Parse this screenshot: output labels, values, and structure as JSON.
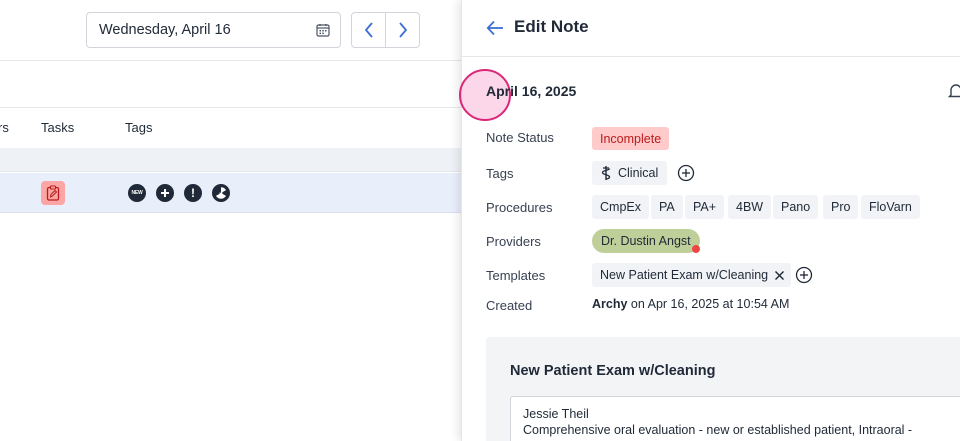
{
  "toolbar": {
    "date_value": "Wednesday, April 16"
  },
  "table": {
    "columns": [
      "rs",
      "Tasks",
      "Tags"
    ]
  },
  "panel": {
    "title": "Edit Note",
    "note_date": "April 16, 2025",
    "labels": {
      "status": "Note Status",
      "tags": "Tags",
      "procedures": "Procedures",
      "providers": "Providers",
      "templates": "Templates",
      "created": "Created"
    },
    "status": "Incomplete",
    "tag": "Clinical",
    "procedures": [
      "CmpEx",
      "PA",
      "PA+",
      "4BW",
      "Pano",
      "Pro",
      "FloVarn"
    ],
    "provider": "Dr. Dustin Angst",
    "template": "New Patient Exam w/Cleaning",
    "created_by": "Archy",
    "created_on": "on Apr 16, 2025 at 10:54 AM",
    "card": {
      "title": "New Patient Exam w/Cleaning",
      "patient": "Jessie Theil",
      "body": "Comprehensive oral evaluation - new or established patient, Intraoral -"
    }
  },
  "colors": {
    "accent": "#3b6fd4",
    "status_bg": "#fecaca",
    "status_text": "#b91c1c",
    "provider_bg": "#bfcf9a",
    "row_selected": "#e9eefb"
  },
  "icons": [
    "calendar-icon",
    "chevron-left-icon",
    "chevron-right-icon",
    "clipboard-edit-icon",
    "new-badge-icon",
    "plus-circle-icon",
    "exclamation-icon",
    "radiation-icon",
    "arrow-left-icon",
    "bell-icon",
    "caduceus-icon",
    "close-icon"
  ]
}
